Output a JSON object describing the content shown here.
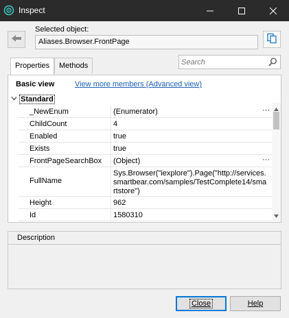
{
  "window": {
    "title": "Inspect"
  },
  "selected": {
    "label": "Selected object:",
    "value": "Aliases.Browser.FrontPage"
  },
  "search": {
    "placeholder": "Search"
  },
  "tabs": [
    {
      "label": "Properties"
    },
    {
      "label": "Methods"
    }
  ],
  "view": {
    "basic_label": "Basic view",
    "advanced_link": "View more members (Advanced view)"
  },
  "category": {
    "label": "Standard"
  },
  "properties": [
    {
      "name": "_NewEnum",
      "value": "(Enumerator)",
      "has_button": true
    },
    {
      "name": "ChildCount",
      "value": "4"
    },
    {
      "name": "Enabled",
      "value": "true"
    },
    {
      "name": "Exists",
      "value": "true"
    },
    {
      "name": "FrontPageSearchBox",
      "value": "(Object)",
      "has_button": true
    },
    {
      "name": "FullName",
      "value": "Sys.Browser(\"iexplore\").Page(\"http://services.smartbear.com/samples/TestComplete14/smartstore\")"
    },
    {
      "name": "Height",
      "value": "962"
    },
    {
      "name": "Id",
      "value": "1580310"
    }
  ],
  "description": {
    "label": "Description"
  },
  "buttons": {
    "close": "Close",
    "help": "Help",
    "ellipsis": "···"
  },
  "colors": {
    "titlebar": "#2b2b2b",
    "link": "#1a5fb4",
    "accent": "#0078d7"
  }
}
